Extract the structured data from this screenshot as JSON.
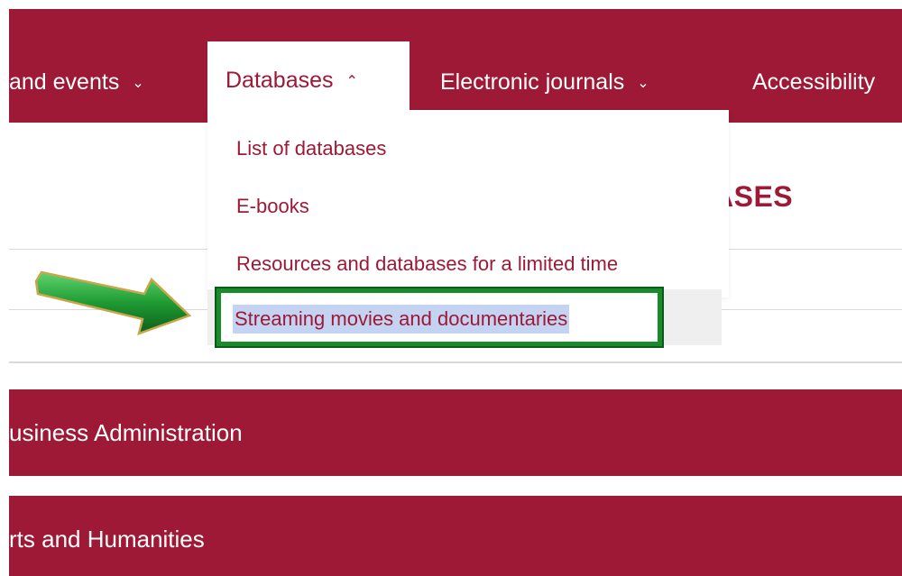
{
  "nav": {
    "items": [
      {
        "label": "and events",
        "chevron": "⌄"
      },
      {
        "label": "Databases",
        "chevron": "⌃"
      },
      {
        "label": "Electronic journals",
        "chevron": "⌄"
      },
      {
        "label": "Accessibility"
      }
    ]
  },
  "heading": {
    "text": "ASES"
  },
  "dropdown": {
    "items": [
      {
        "label": "List of databases"
      },
      {
        "label": "E-books"
      },
      {
        "label": "Resources and databases for a limited time"
      },
      {
        "label": "Streaming movies and documentaries"
      }
    ]
  },
  "categories": [
    {
      "label": "usiness Administration"
    },
    {
      "label": "rts and Humanities"
    }
  ],
  "colors": {
    "brand": "#9d1935",
    "highlight_border": "#1b8a2a",
    "selection": "#c3d3f1"
  }
}
